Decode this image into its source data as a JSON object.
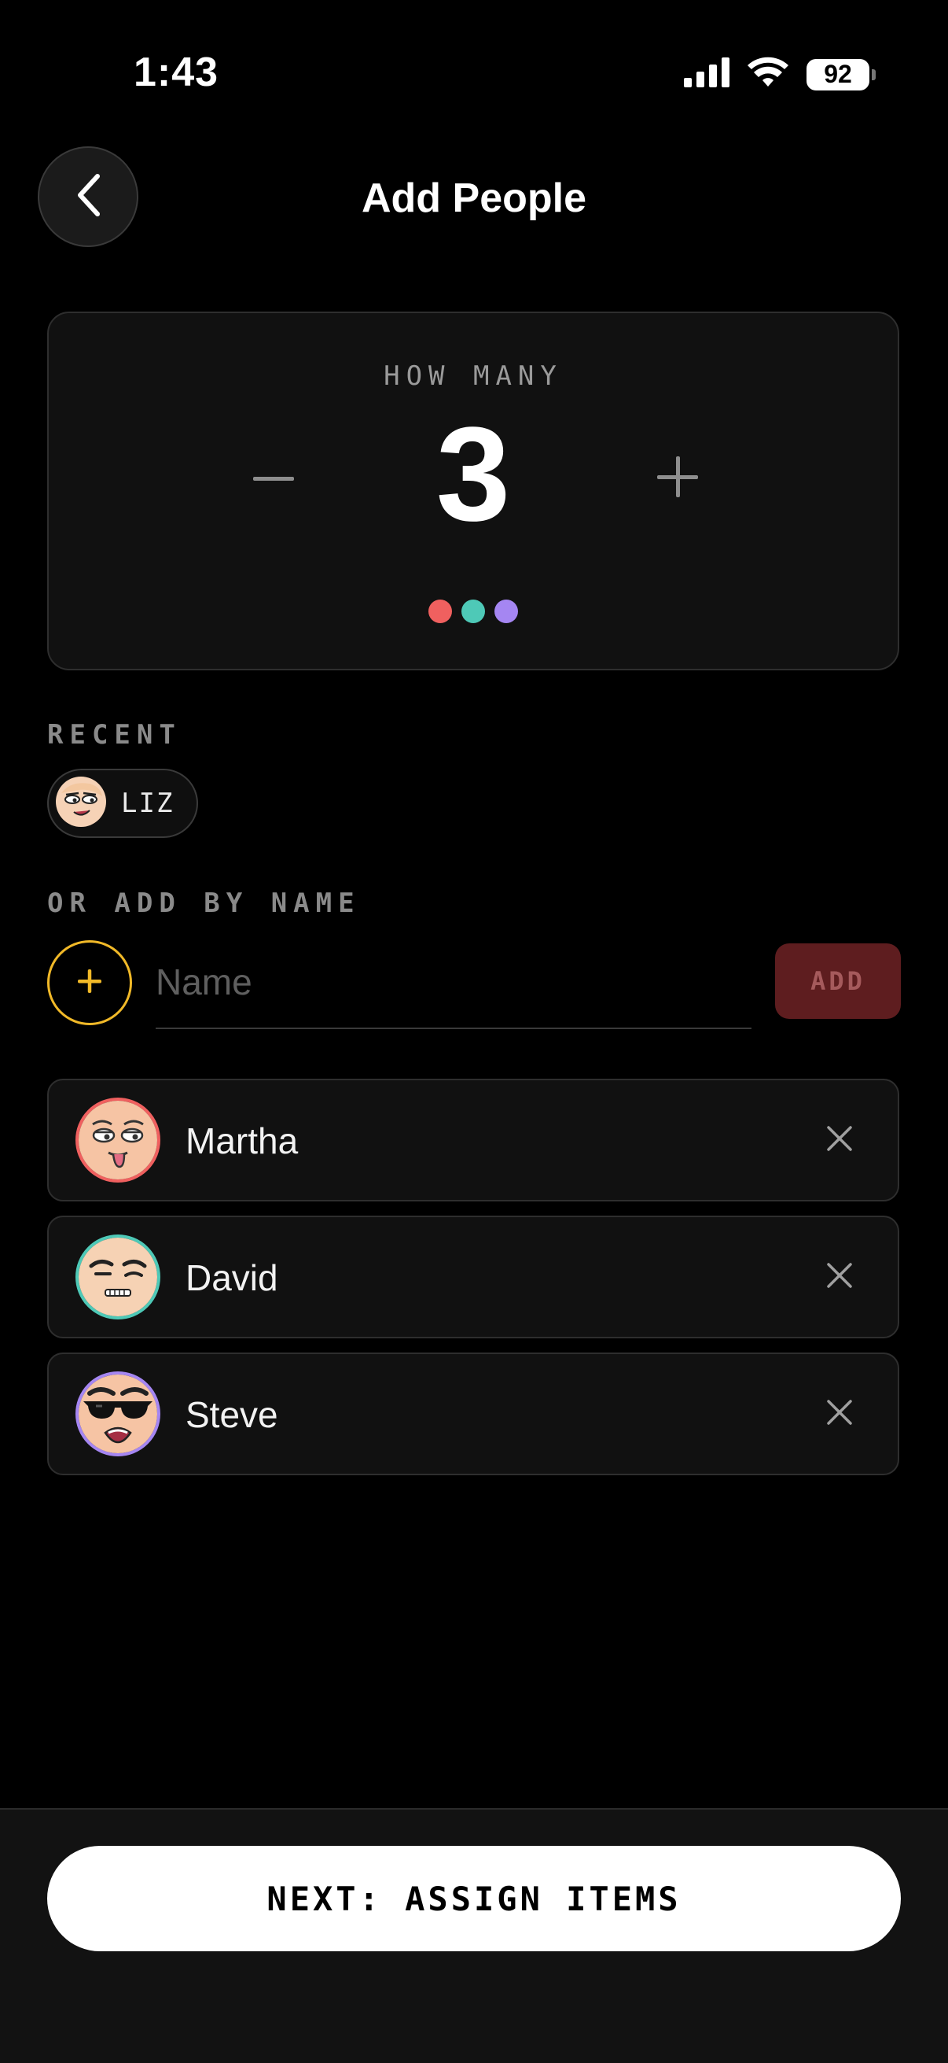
{
  "status_bar": {
    "time": "1:43",
    "battery": "92",
    "icons": [
      "signal-icon",
      "wifi-icon",
      "battery-icon"
    ]
  },
  "header": {
    "title": "Add People",
    "back_icon": "chevron-left-icon"
  },
  "count_card": {
    "label": "HOW MANY",
    "value": "3",
    "dot_colors": [
      "#f0605f",
      "#4ec9b7",
      "#a586f2"
    ]
  },
  "recent": {
    "label": "RECENT",
    "people": [
      {
        "name": "LIZ"
      }
    ]
  },
  "add_by_name": {
    "label": "OR ADD BY NAME",
    "input_value": "",
    "input_placeholder": "Name",
    "add_label": "ADD",
    "accent": "#f1b928"
  },
  "people": [
    {
      "name": "Martha",
      "ring_color": "#f0605f"
    },
    {
      "name": "David",
      "ring_color": "#4ec9b7"
    },
    {
      "name": "Steve",
      "ring_color": "#a586f2"
    }
  ],
  "footer": {
    "next_label": "NEXT: ASSIGN ITEMS"
  }
}
